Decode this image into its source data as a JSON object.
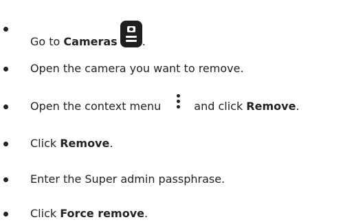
{
  "steps": [
    {
      "before": "Go to ",
      "bold": "Cameras",
      "after": "."
    },
    {
      "before": "Open the camera you want to remove.",
      "bold": "",
      "after": ""
    },
    {
      "before": "Open the context menu",
      "bold": "Remove",
      "after": ".",
      "middle": "and click "
    },
    {
      "before": "Click ",
      "bold": "Remove",
      "after": "."
    },
    {
      "before": "Enter the Super admin passphrase.",
      "bold": "",
      "after": ""
    },
    {
      "before": "Click ",
      "bold": "Force remove",
      "after": "."
    }
  ],
  "icons": {
    "cameras": "camera-icon",
    "context_menu": "more-vertical-icon"
  }
}
